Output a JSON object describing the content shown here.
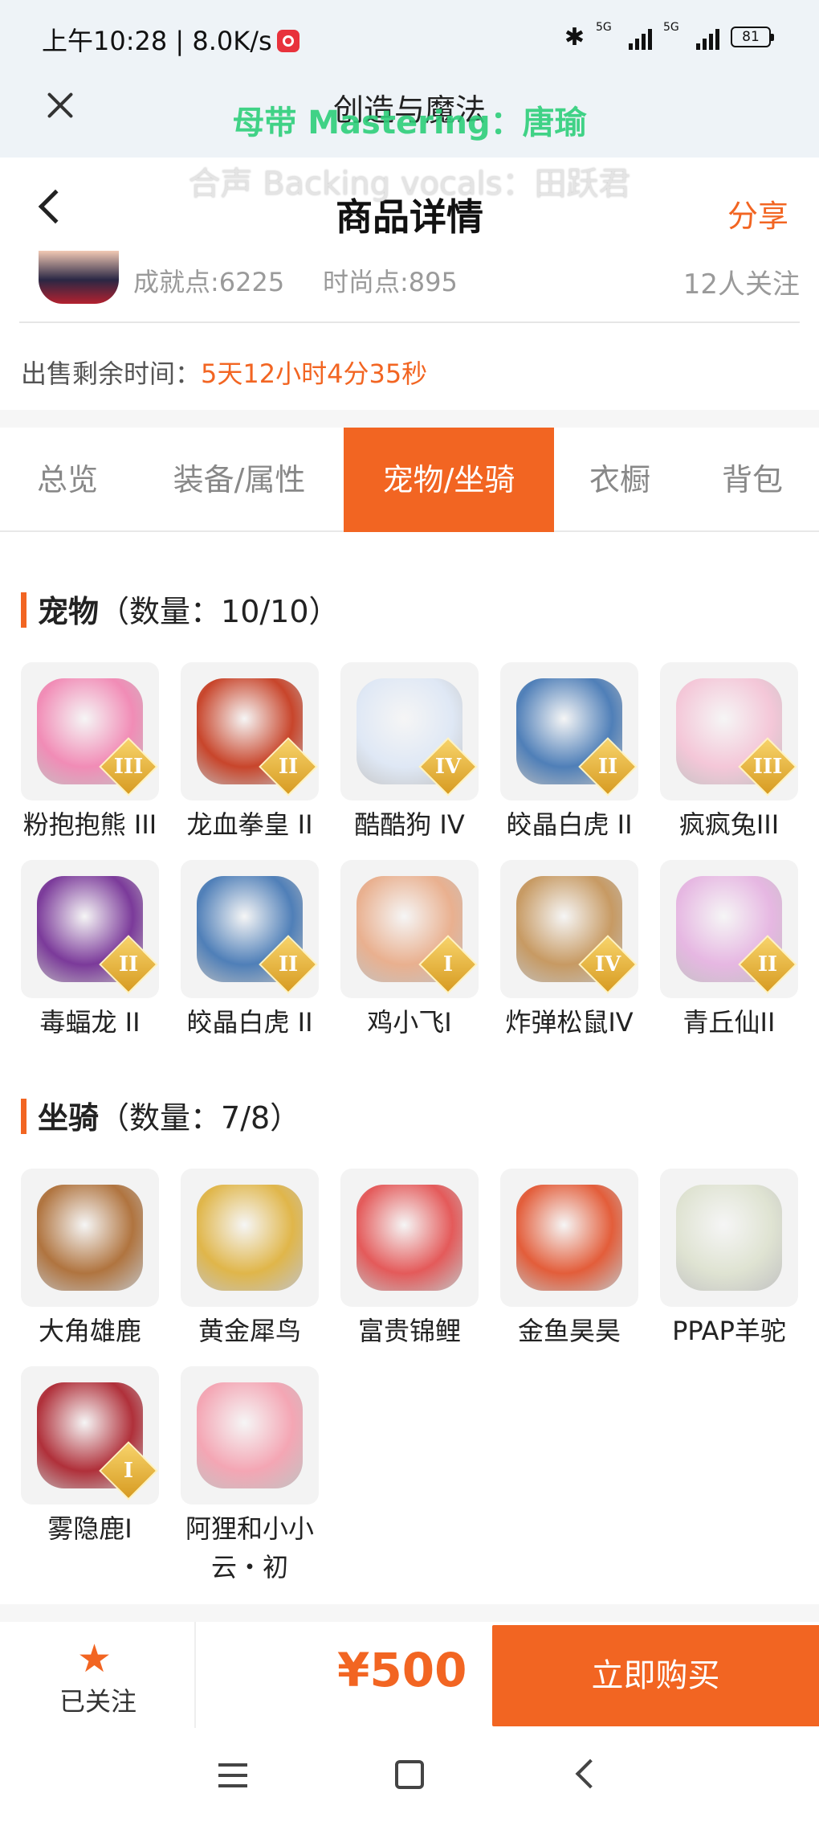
{
  "status_bar": {
    "time": "上午10:28 | 8.0K/s",
    "signal1": "5G",
    "signal2": "5G",
    "battery": "81"
  },
  "player": {
    "song_title": "创造与魔法",
    "lyric_line1": "母带 Mastering：唐瑜",
    "lyric_line2": "合声 Backing vocals：田跃君"
  },
  "header": {
    "title": "商品详情",
    "share_label": "分享"
  },
  "seller": {
    "achievement": "成就点:6225",
    "fashion": "时尚点:895",
    "followers": "12人关注"
  },
  "sale": {
    "label": "出售剩余时间：",
    "remaining": "5天12小时4分35秒"
  },
  "tabs": [
    {
      "label": "总览"
    },
    {
      "label": "装备/属性"
    },
    {
      "label": "宠物/坐骑",
      "active": true
    },
    {
      "label": "衣橱"
    },
    {
      "label": "背包"
    }
  ],
  "pets_section": {
    "title": "宠物",
    "count": "（数量：10/10）"
  },
  "pets": [
    {
      "name": "粉抱抱熊 III",
      "rank": "III",
      "color": "#f18cb6",
      "icon": "pink-bear-icon"
    },
    {
      "name": "龙血拳皇 II",
      "rank": "II",
      "color": "#c8452b",
      "icon": "dragon-boxer-icon"
    },
    {
      "name": "酷酷狗 IV",
      "rank": "IV",
      "color": "#dfe8f5",
      "icon": "cool-dog-icon"
    },
    {
      "name": "皎晶白虎 II",
      "rank": "II",
      "color": "#4f7fb8",
      "icon": "crystal-tiger-icon"
    },
    {
      "name": "疯疯兔III",
      "rank": "III",
      "color": "#f4c7d8",
      "icon": "crazy-rabbit-icon"
    },
    {
      "name": "毒蝠龙 II",
      "rank": "II",
      "color": "#7b3a9a",
      "icon": "bat-dragon-icon"
    },
    {
      "name": "皎晶白虎 II",
      "rank": "II",
      "color": "#4f7fb8",
      "icon": "crystal-tiger-icon"
    },
    {
      "name": "鸡小飞I",
      "rank": "I",
      "color": "#e9b08f",
      "icon": "chick-fighter-icon"
    },
    {
      "name": "炸弹松鼠IV",
      "rank": "IV",
      "color": "#c79a63",
      "icon": "bomb-squirrel-icon"
    },
    {
      "name": "青丘仙II",
      "rank": "II",
      "color": "#e6b7e2",
      "icon": "fox-fairy-icon"
    }
  ],
  "mounts_section": {
    "title": "坐骑",
    "count": "（数量：7/8）"
  },
  "mounts": [
    {
      "name": "大角雄鹿",
      "rank": "",
      "color": "#b0743f",
      "icon": "stag-icon"
    },
    {
      "name": "黄金犀鸟",
      "rank": "",
      "color": "#e0b64a",
      "icon": "hornbill-icon"
    },
    {
      "name": "富贵锦鲤",
      "rank": "",
      "color": "#e45a5a",
      "icon": "koi-icon"
    },
    {
      "name": "金鱼昊昊",
      "rank": "",
      "color": "#e35d3a",
      "icon": "goldfish-icon"
    },
    {
      "name": "PPAP羊驼",
      "rank": "",
      "color": "#dfe3d2",
      "icon": "alpaca-icon"
    },
    {
      "name": "雾隐鹿I",
      "rank": "I",
      "color": "#b0303a",
      "icon": "mist-deer-icon"
    },
    {
      "name": "阿狸和小小云・初",
      "rank": "",
      "color": "#f4a6b4",
      "icon": "ali-fox-cloud-icon"
    }
  ],
  "bottom": {
    "follow_label": "已关注",
    "price": "¥500",
    "buy_label": "立即购买"
  }
}
